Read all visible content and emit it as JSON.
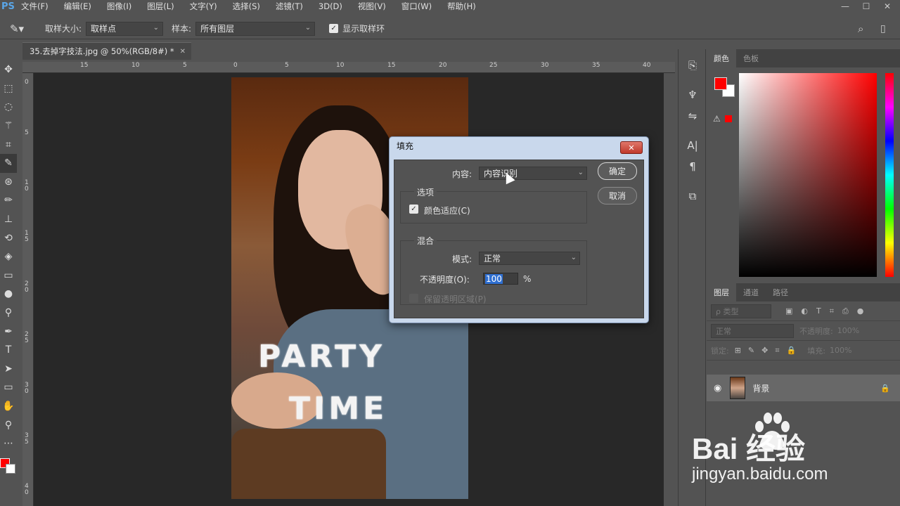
{
  "app": {
    "logo": "PS"
  },
  "menu": [
    "文件(F)",
    "编辑(E)",
    "图像(I)",
    "图层(L)",
    "文字(Y)",
    "选择(S)",
    "滤镜(T)",
    "3D(D)",
    "视图(V)",
    "窗口(W)",
    "帮助(H)"
  ],
  "window_controls": {
    "minimize": "—",
    "maximize": "☐",
    "close": "✕"
  },
  "options_bar": {
    "sample_size_label": "取样大小:",
    "sample_size_value": "取样点",
    "sample_label": "样本:",
    "sample_value": "所有图层",
    "show_ring_label": "显示取样环",
    "show_ring_checked": true
  },
  "document": {
    "tab_title": "35.去掉字技法.jpg @ 50%(RGB/8#) *",
    "close_glyph": "✕",
    "ruler_h": [
      "15",
      "10",
      "5",
      "0",
      "5",
      "10",
      "15",
      "20",
      "25",
      "30",
      "35",
      "40"
    ],
    "ruler_v": [
      "0",
      "5",
      "1 0",
      "1 5",
      "2 0",
      "2 5",
      "3 0",
      "3 5",
      "4 0"
    ],
    "overlay_text_line1": "PARTY",
    "overlay_text_line2": "TIME"
  },
  "tools": [
    "move-icon",
    "marquee-icon",
    "lasso-icon",
    "magic-wand-icon",
    "crop-icon",
    "eyedropper-icon",
    "patch-icon",
    "brush-icon",
    "stamp-icon",
    "history-brush-icon",
    "eraser-icon",
    "gradient-icon",
    "blur-icon",
    "dodge-icon",
    "pen-icon",
    "type-icon",
    "path-select-icon",
    "rectangle-icon",
    "hand-icon",
    "zoom-icon",
    "more-icon"
  ],
  "fill_dialog": {
    "title": "填充",
    "close_glyph": "✕",
    "content_label": "内容:",
    "content_value": "内容识别",
    "options_group": "选项",
    "color_adapt_label": "颜色适应(C)",
    "color_adapt_checked": true,
    "blend_group": "混合",
    "mode_label": "模式:",
    "mode_value": "正常",
    "opacity_label": "不透明度(O):",
    "opacity_value": "100",
    "opacity_unit": "%",
    "preserve_label": "保留透明区域(P)",
    "ok_button": "确定",
    "cancel_button": "取消"
  },
  "color_panel": {
    "tabs": [
      "颜色",
      "色板"
    ],
    "fg_color": "#ff0000",
    "bg_color": "#ffffff"
  },
  "layers_panel": {
    "tabs": [
      "图层",
      "通道",
      "路径"
    ],
    "filter_label": "ρ 类型",
    "blend_mode": "正常",
    "opacity_label": "不透明度:",
    "opacity_value": "100%",
    "lock_label": "锁定:",
    "fill_label": "填充:",
    "fill_value": "100%",
    "layer_name": "背景"
  },
  "watermark": {
    "brand": "Bai  经验",
    "url": "jingyan.baidu.com"
  }
}
